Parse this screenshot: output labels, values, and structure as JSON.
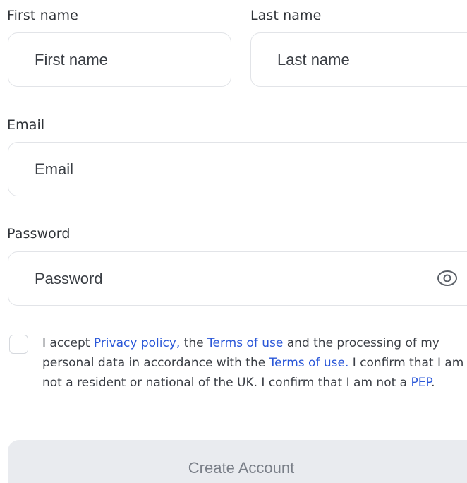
{
  "form": {
    "first_name": {
      "label": "First name",
      "placeholder": "First name"
    },
    "last_name": {
      "label": "Last name",
      "placeholder": "Last name"
    },
    "email": {
      "label": "Email",
      "placeholder": "Email"
    },
    "password": {
      "label": "Password",
      "placeholder": "Password",
      "icon": "eye-icon"
    }
  },
  "consent": {
    "checked": false,
    "text_1": "I accept ",
    "link_privacy": "Privacy policy,",
    "text_2": " the ",
    "link_terms_1": "Terms of use",
    "text_3": " and the processing of my personal data in accordance with the ",
    "link_terms_2": "Terms of use.",
    "text_4": " I confirm that I am not a resident or national of the UK. I confirm that I am not a ",
    "link_pep": "PEP",
    "text_5": "."
  },
  "submit": {
    "label": "Create Account",
    "enabled": false
  },
  "colors": {
    "link": "#2a57d8",
    "button_bg": "#e9ebef",
    "button_text": "#7a7f88",
    "border": "#e2e4e8"
  }
}
